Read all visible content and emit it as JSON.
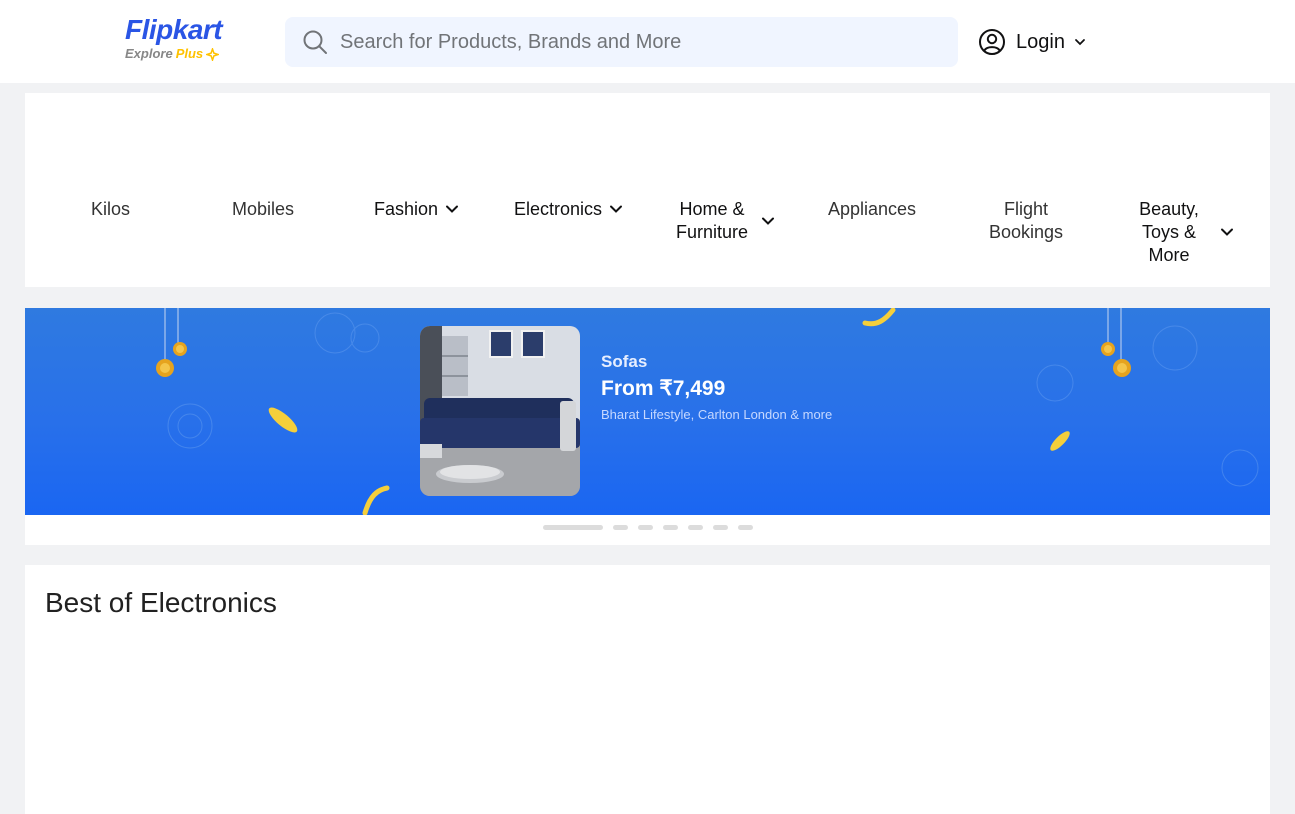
{
  "header": {
    "logo_main": "Flipkart",
    "logo_explore": "Explore",
    "logo_plus": "Plus",
    "search_placeholder": "Search for Products, Brands and More",
    "login_label": "Login",
    "icons": {
      "search": "search-icon",
      "account": "user-circle-icon",
      "chevron": "chevron-down-icon"
    }
  },
  "categories": [
    {
      "label": "Kilos",
      "has_dropdown": false
    },
    {
      "label": "Mobiles",
      "has_dropdown": false
    },
    {
      "label": "Fashion",
      "has_dropdown": true
    },
    {
      "label": "Electronics",
      "has_dropdown": true
    },
    {
      "label": "Home & Furniture",
      "has_dropdown": true
    },
    {
      "label": "Appliances",
      "has_dropdown": false
    },
    {
      "label": "Flight Bookings",
      "has_dropdown": false
    },
    {
      "label": "Beauty, Toys & More",
      "has_dropdown": true
    }
  ],
  "banner": {
    "title": "Sofas",
    "price": "From ₹7,499",
    "subtitle": "Bharat Lifestyle, Carlton London & more",
    "slide_count": 7,
    "active_slide": 1
  },
  "section": {
    "title": "Best of Electronics"
  },
  "colors": {
    "brand_blue": "#2a55e5",
    "brand_yellow": "#ffc200",
    "search_bg": "#f0f5ff",
    "banner_blue": "#2870ea",
    "page_bg": "#f1f2f4"
  }
}
